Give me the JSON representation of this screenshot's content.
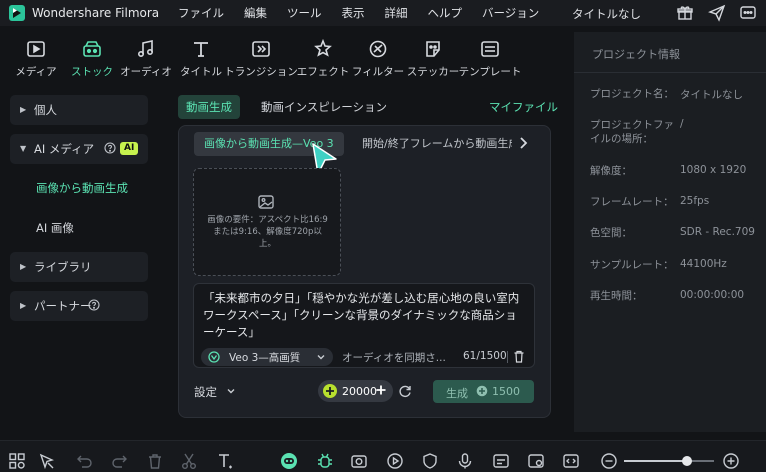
{
  "app": {
    "name": "Wondershare Filmora",
    "project_title": "タイトルなし",
    "menu": [
      "ファイル",
      "編集",
      "ツール",
      "表示",
      "詳細",
      "ヘルプ",
      "バージョン"
    ]
  },
  "toolbar": {
    "items": [
      {
        "label": "メディア",
        "icon": "media-icon"
      },
      {
        "label": "ストック",
        "icon": "stock-icon",
        "active": true
      },
      {
        "label": "オーディオ",
        "icon": "audio-icon"
      },
      {
        "label": "タイトル",
        "icon": "title-icon"
      },
      {
        "label": "トランジション",
        "icon": "transition-icon"
      },
      {
        "label": "エフェクト",
        "icon": "effect-icon"
      },
      {
        "label": "フィルター",
        "icon": "filter-icon"
      },
      {
        "label": "ステッカー",
        "icon": "sticker-icon"
      },
      {
        "label": "テンプレート",
        "icon": "template-icon"
      }
    ]
  },
  "sidebar": {
    "personal": "個人",
    "ai_media": "AI メディア",
    "ai_badge": "AI",
    "image_to_video": "画像から動画生成",
    "ai_image": "AI 画像",
    "library": "ライブラリ",
    "partner": "パートナー"
  },
  "main": {
    "tabs": [
      "動画生成",
      "動画インスピレーション"
    ],
    "my_files": "マイファイル",
    "sub_tabs": [
      "画像から動画生成—Veo 3",
      "開始/終了フレームから動画生成"
    ],
    "dropzone_text": "画像の要件：アスペクト比16:9または9:16、解像度720p以上。",
    "prompt": "「未来都市の夕日」「穏やかな光が差し込む居心地の良い室内ワークスペース」「クリーンな背景のダイナミックな商品ショーケース」",
    "model": "Veo 3—高画質",
    "audio_sync": "オーディオを同期さ...",
    "char_count": "61/1500",
    "settings": "設定",
    "credits": "20000",
    "generate": "生成",
    "generate_cost": "1500"
  },
  "project_info": {
    "header": "プロジェクト情報",
    "rows": [
      {
        "label": "プロジェクト名：",
        "value": "タイトルなし"
      },
      {
        "label": "プロジェクトファイルの場所：",
        "value": "/"
      },
      {
        "label": "解像度：",
        "value": "1080 x 1920"
      },
      {
        "label": "フレームレート：",
        "value": "25fps"
      },
      {
        "label": "色空間：",
        "value": "SDR - Rec.709"
      },
      {
        "label": "サンプルレート：",
        "value": "44100Hz"
      },
      {
        "label": "再生時間：",
        "value": "00:00:00:00"
      }
    ]
  },
  "colors": {
    "accent": "#5be2b2",
    "background": "#121417",
    "panel": "#1b1e22"
  },
  "zoom_level": 0.7
}
